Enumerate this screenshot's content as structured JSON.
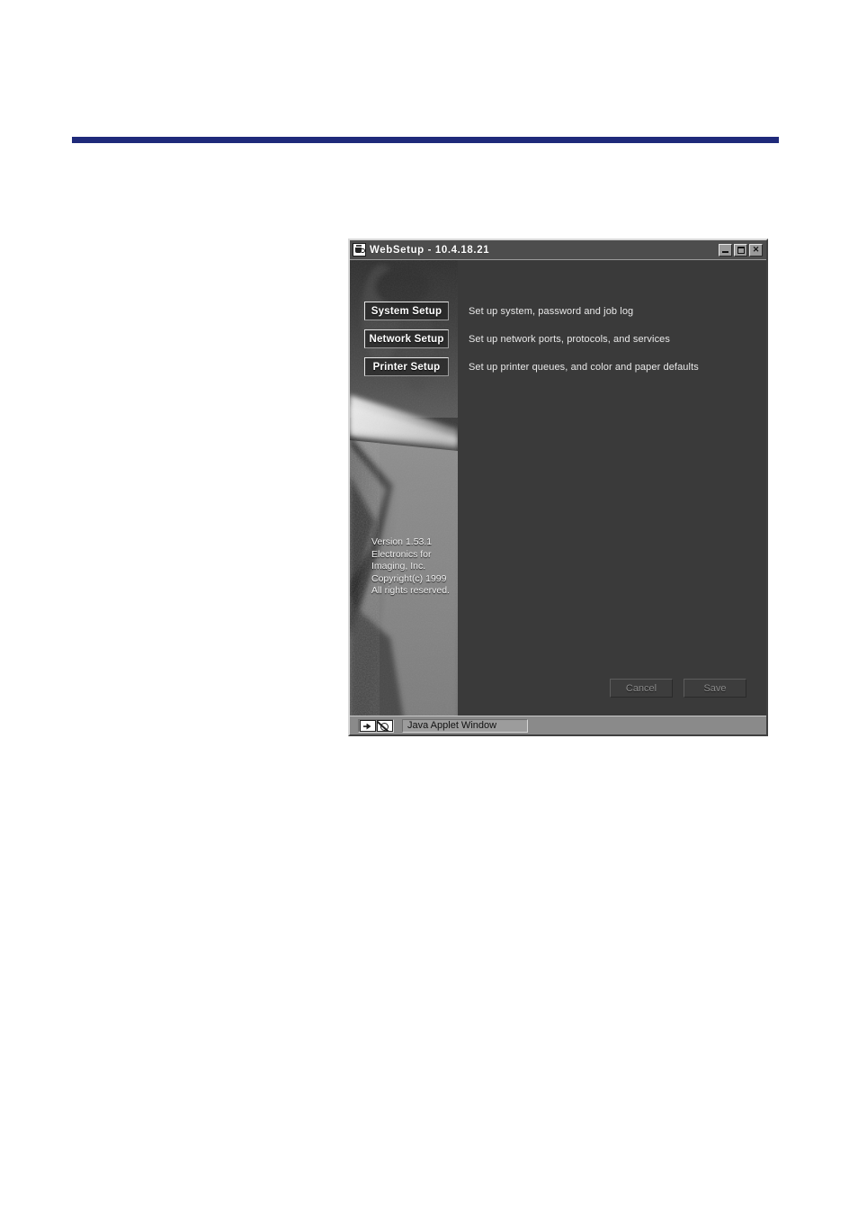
{
  "page": {
    "rule_color": "#1f2a7a"
  },
  "dialog": {
    "title": "WebSetup - 10.4.18.21",
    "title_icon": "java-coffee-cup-icon",
    "window_controls": {
      "minimize_label": "_",
      "maximize_label": "□",
      "close_label": "✕"
    },
    "menu": [
      {
        "button_label": "System Setup",
        "description": "Set up system, password and job log"
      },
      {
        "button_label": "Network Setup",
        "description": "Set up network ports, protocols, and services"
      },
      {
        "button_label": "Printer Setup",
        "description": "Set up printer queues, and color and paper defaults"
      }
    ],
    "version_info": {
      "line1": "Version 1.53.1",
      "line2": "Electronics for",
      "line3": "Imaging, Inc.",
      "line4": "Copyright(c) 1999",
      "line5": "All rights reserved."
    },
    "actions": {
      "cancel_label": "Cancel",
      "save_label": "Save"
    },
    "statusbar": {
      "text": "Java Applet Window",
      "icon1": "applet-signal-icon",
      "icon2": "applet-warning-icon"
    },
    "colors": {
      "body_bg": "#3a3a3a",
      "titlebar_bg": "#4d4d4d",
      "frame_bg": "#808080",
      "statusbar_bg": "#8a8a8a"
    }
  }
}
